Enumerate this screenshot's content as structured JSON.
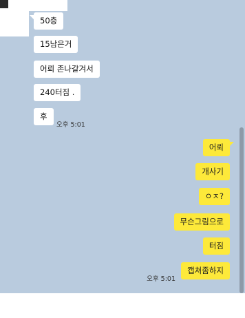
{
  "incoming": {
    "messages": [
      "50층",
      "15남은거",
      "어뢰 존나갈겨서",
      "240터짐 .",
      "후"
    ],
    "time": "오후 5:01"
  },
  "outgoing": {
    "messages": [
      "어뢰",
      "개사기",
      "ㅇㅈ?",
      "무슨그림으로",
      "터짐",
      "캡쳐좀하지"
    ],
    "time": "오후 5:01"
  },
  "colors": {
    "chat_background": "#b9cbde",
    "incoming_bubble": "#ffffff",
    "outgoing_bubble": "#fde93a"
  }
}
